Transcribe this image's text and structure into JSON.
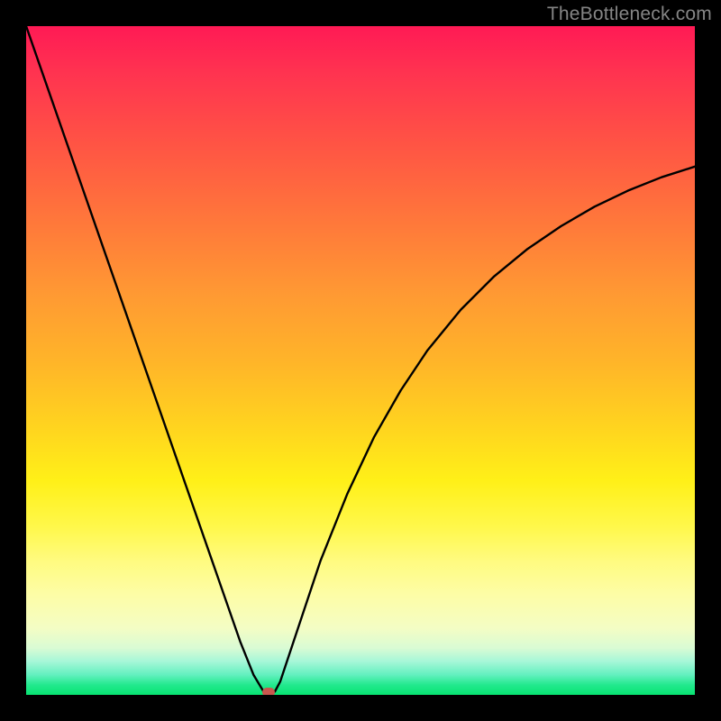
{
  "watermark": "TheBottleneck.com",
  "chart_data": {
    "type": "line",
    "title": "",
    "xlabel": "",
    "ylabel": "",
    "xlim": [
      0,
      100
    ],
    "ylim": [
      0,
      100
    ],
    "grid": false,
    "legend": false,
    "series": [
      {
        "name": "bottleneck-curve",
        "x": [
          0,
          4,
          8,
          12,
          16,
          20,
          24,
          28,
          32,
          34,
          35.5,
          36.3,
          37.2,
          38,
          40,
          44,
          48,
          52,
          56,
          60,
          65,
          70,
          75,
          80,
          85,
          90,
          95,
          100
        ],
        "y": [
          100,
          88.5,
          77,
          65.5,
          54,
          42.5,
          31,
          19.5,
          8,
          3,
          0.5,
          0,
          0.5,
          2,
          8,
          20,
          30,
          38.5,
          45.5,
          51.5,
          57.6,
          62.6,
          66.7,
          70.1,
          73,
          75.4,
          77.4,
          79
        ]
      }
    ],
    "marker": {
      "x": 36.3,
      "y": 0.4
    },
    "background_gradient": {
      "top": "#ff1a55",
      "mid": "#ffd41f",
      "bottom": "#07e371"
    }
  }
}
